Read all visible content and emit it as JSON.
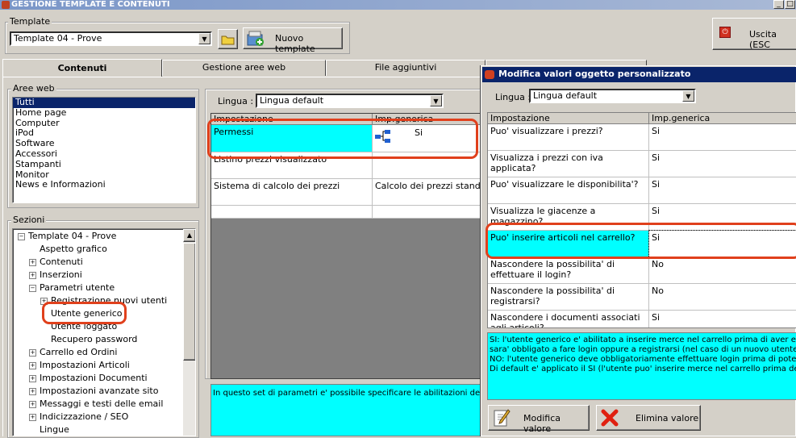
{
  "window": {
    "title": "GESTIONE TEMPLATE E CONTENUTI"
  },
  "template_group": {
    "legend": "Template",
    "selected": "Template 04 - Prove",
    "new_button": "Nuovo template"
  },
  "exit_button": {
    "label": "Uscita (ESC"
  },
  "tabs": [
    {
      "label": "Contenuti"
    },
    {
      "label": "Gestione aree web"
    },
    {
      "label": "File aggiuntivi"
    }
  ],
  "aree_web": {
    "legend": "Aree web",
    "items": [
      "Tutti",
      "Home page",
      "Computer",
      "iPod",
      "Software",
      "Accessori",
      "Stampanti",
      "Monitor",
      "News e Informazioni"
    ]
  },
  "sezioni": {
    "legend": "Sezioni",
    "tree": [
      {
        "label": "Template 04 - Prove",
        "expander": "−"
      },
      {
        "label": "Aspetto grafico",
        "expander": ""
      },
      {
        "label": "Contenuti",
        "expander": "+"
      },
      {
        "label": "Inserzioni",
        "expander": "+"
      },
      {
        "label": "Parametri utente",
        "expander": "−"
      },
      {
        "label": "Registrazione nuovi utenti",
        "expander": "+"
      },
      {
        "label": "Utente generico",
        "expander": ""
      },
      {
        "label": "Utente loggato",
        "expander": ""
      },
      {
        "label": "Recupero password",
        "expander": ""
      },
      {
        "label": "Carrello ed Ordini",
        "expander": "+"
      },
      {
        "label": "Impostazioni Articoli",
        "expander": "+"
      },
      {
        "label": "Impostazioni Documenti",
        "expander": "+"
      },
      {
        "label": "Impostazioni avanzate sito",
        "expander": "+"
      },
      {
        "label": "Messaggi e testi delle email",
        "expander": "+"
      },
      {
        "label": "Indicizzazione / SEO",
        "expander": "+"
      },
      {
        "label": "Lingue",
        "expander": ""
      }
    ]
  },
  "main_grid": {
    "lingua_label": "Lingua :",
    "lingua_value": "Lingua default",
    "headers": [
      "Impostazione",
      "Imp.generica"
    ],
    "rows": [
      {
        "name": "Permessi",
        "value": "Si"
      },
      {
        "name": "Listino prezzi visualizzato",
        "value": ""
      },
      {
        "name": "Sistema di calcolo dei prezzi",
        "value": "Calcolo dei prezzi standard"
      }
    ],
    "description": "In questo set di parametri e' possibile specificare le abilitazioni dell'ute"
  },
  "dialog": {
    "title": "Modifica valori oggetto personalizzato",
    "lingua_label": "Lingua :",
    "lingua_value": "Lingua default",
    "headers": [
      "Impostazione",
      "Imp.generica"
    ],
    "rows": [
      {
        "name": "Puo' visualizzare i prezzi?",
        "value": "Si"
      },
      {
        "name": "Visualizza i prezzi con iva applicata?",
        "value": "Si"
      },
      {
        "name": "Puo' visualizzare le disponibilita'?",
        "value": "Si"
      },
      {
        "name": "Visualizza le giacenze a magazzino?",
        "value": "Si"
      },
      {
        "name": "Puo' inserire articoli nel carrello?",
        "value": "Si"
      },
      {
        "name": "Nascondere la possibilita' di effettuare il login?",
        "value": "No"
      },
      {
        "name": "Nascondere la possibilita' di registrarsi?",
        "value": "No"
      },
      {
        "name": "Nascondere i documenti associati agli articoli?",
        "value": "Si"
      }
    ],
    "help_lines": [
      "SI: l'utente generico e' abilitato a inserire merce nel carrello prima di aver effettu",
      "sara' obbligato a fare login oppure a registrarsi (nel caso di un nuovo utente).",
      "NO: l'utente generico deve obbligatoriamente effettuare login prima di poter inse",
      "Di default e' applicato il SI (l'utente puo' inserire merce nel carrello prima del login"
    ],
    "modify_button": "Modifica valore",
    "delete_button": "Elimina valore"
  },
  "colors": {
    "highlight": "#00ffff",
    "selection": "#0a246a",
    "annotation": "#e0401c"
  }
}
